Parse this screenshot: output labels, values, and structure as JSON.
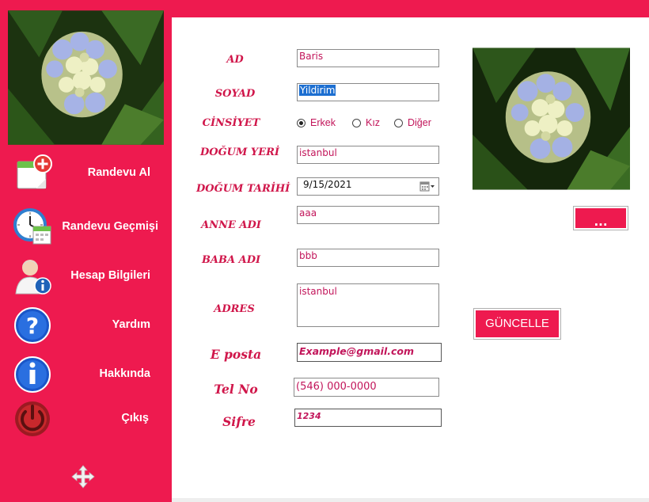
{
  "sidebar": {
    "items": [
      {
        "label": "Randevu Al",
        "icon": "calendar-add-icon"
      },
      {
        "label": "Randevu Geçmişi",
        "icon": "clock-calendar-icon"
      },
      {
        "label": "Hesap Bilgileri",
        "icon": "user-info-icon"
      },
      {
        "label": "Yardım",
        "icon": "help-icon"
      },
      {
        "label": "Hakkında",
        "icon": "info-icon"
      },
      {
        "label": "Çıkış",
        "icon": "power-icon"
      }
    ],
    "move_icon": "move-icon"
  },
  "form": {
    "ad": {
      "label": "AD",
      "value": "Baris"
    },
    "soyad": {
      "label": "SOYAD",
      "value": "Yildirim"
    },
    "cinsiyet": {
      "label": "CİNSİYET",
      "options": [
        "Erkek",
        "Kız",
        "Diğer"
      ],
      "selected": "Erkek"
    },
    "dogum_yeri": {
      "label": "DOĞUM YERİ",
      "value": "istanbul"
    },
    "dogum_tarihi": {
      "label": "DOĞUM TARİHİ",
      "value": "9/15/2021"
    },
    "anne_adi": {
      "label": "ANNE ADI",
      "value": "aaa"
    },
    "baba_adi": {
      "label": "BABA ADI",
      "value": "bbb"
    },
    "adres": {
      "label": "ADRES",
      "value": "istanbul"
    },
    "eposta": {
      "label": "E posta",
      "value": "Example@gmail.com"
    },
    "tel": {
      "label": "Tel No",
      "value": "(546) 000-0000"
    },
    "sifre": {
      "label": "Sifre",
      "value": "1234"
    }
  },
  "buttons": {
    "browse": "...",
    "update": "GÜNCELLE"
  },
  "colors": {
    "accent": "#ee1a4f",
    "text": "#c2155a",
    "label": "#d0164a"
  }
}
